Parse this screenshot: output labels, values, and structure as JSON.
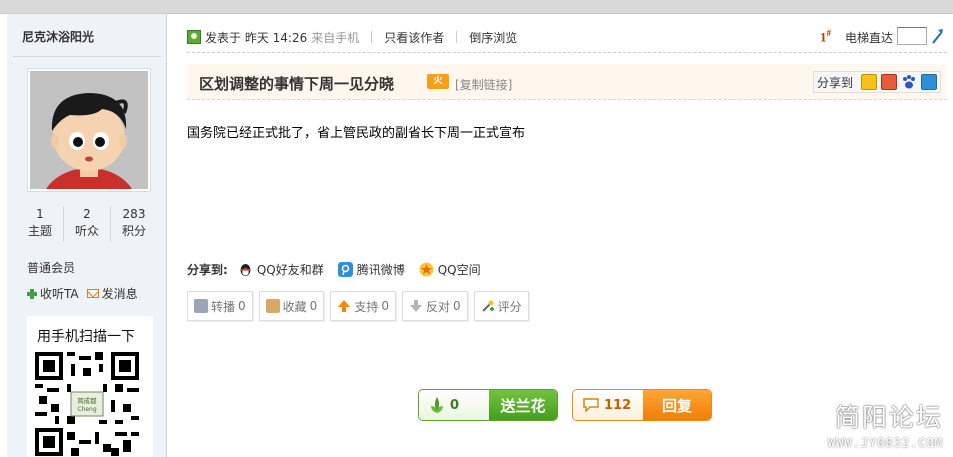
{
  "user": {
    "name": "尼克沐浴阳光",
    "stats": [
      {
        "num": "1",
        "label": "主题"
      },
      {
        "num": "2",
        "label": "听众"
      },
      {
        "num": "283",
        "label": "积分"
      }
    ],
    "rank": "普通会员",
    "follow_label": "收听TA",
    "message_label": "发消息"
  },
  "qr": {
    "title": "用手机扫描一下",
    "center_text": "简成都",
    "center_text2": "Cheng"
  },
  "post": {
    "posted_prefix": "发表于",
    "posted_time": "昨天 14:26",
    "from": "来自手机",
    "only_author": "只看该作者",
    "reverse": "倒序浏览",
    "floor_num": "1",
    "floor_mark": "#",
    "elevator": "电梯直达",
    "title": "区划调整的事情下周一见分晓",
    "hot_badge": "火",
    "copy_link": "[复制链接]",
    "share_to": "分享到",
    "content": "国务院已经正式批了，省上管民政的副省长下周一正式宣布"
  },
  "share_row": {
    "label": "分享到:",
    "items": [
      "QQ好友和群",
      "腾讯微博",
      "QQ空间"
    ]
  },
  "buttons": [
    {
      "label": "转播",
      "count": "0",
      "icon": "relay-icon"
    },
    {
      "label": "收藏",
      "count": "0",
      "icon": "favorite-icon"
    },
    {
      "label": "支持",
      "count": "0",
      "icon": "thumb-up-icon"
    },
    {
      "label": "反对",
      "count": "0",
      "icon": "thumb-down-icon"
    },
    {
      "label": "评分",
      "icon": "rate-icon"
    }
  ],
  "votes": {
    "flower_count": "0",
    "flower_label": "送兰花",
    "reply_count": "112",
    "reply_label": "回复"
  },
  "watermark": {
    "line1": "简阳论坛",
    "line2": "WWW.JY0832.COM"
  },
  "colors": {
    "accent_green": "#459e1f",
    "accent_orange": "#f07d0a",
    "sidebar_bg": "#eef3f7"
  }
}
